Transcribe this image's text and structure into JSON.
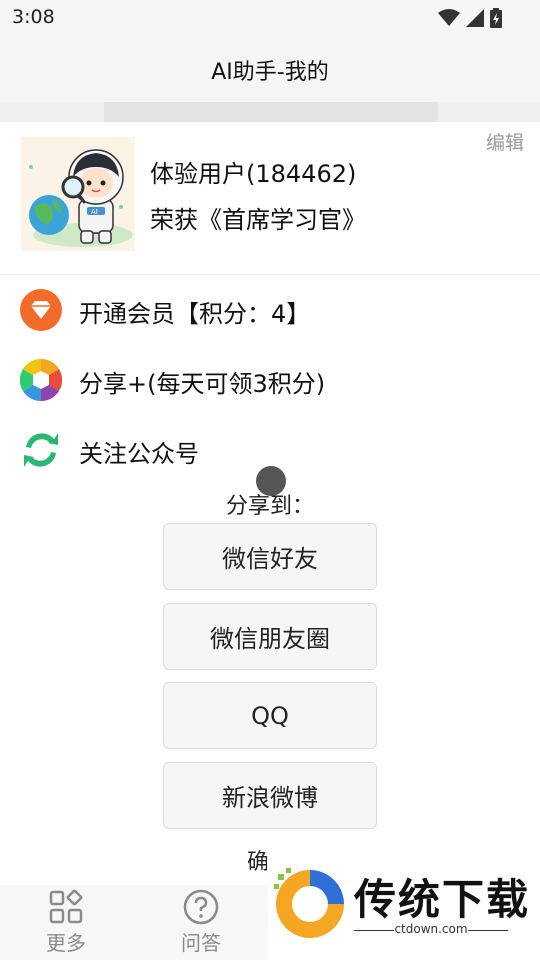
{
  "status_bar": {
    "time": "3:08"
  },
  "app_bar": {
    "title": "AI助手-我的"
  },
  "profile": {
    "name": "体验用户(184462)",
    "title": "荣获《首席学习官》",
    "edit_label": "编辑",
    "avatar_badge": "AI"
  },
  "menu": [
    {
      "label": "开通会员【积分：4】",
      "icon": "diamond-icon"
    },
    {
      "label": "分享+(每天可领3积分)",
      "icon": "shutter-icon"
    },
    {
      "label": "关注公众号",
      "icon": "wechat-official-icon"
    }
  ],
  "share_dialog": {
    "title": "分享到：",
    "options": [
      "微信好友",
      "微信朋友圈",
      "QQ",
      "新浪微博"
    ],
    "cancel_partial": "确"
  },
  "bottom_nav": [
    {
      "label": "更多",
      "icon": "grid-icon"
    },
    {
      "label": "问答",
      "icon": "question-icon"
    }
  ],
  "watermark": {
    "text": "传统下载",
    "url": "ctdown.com"
  },
  "colors": {
    "accent_orange": "#f26b2a",
    "wechat_green": "#2bb673",
    "bg_bar": "#f5f5f5"
  }
}
